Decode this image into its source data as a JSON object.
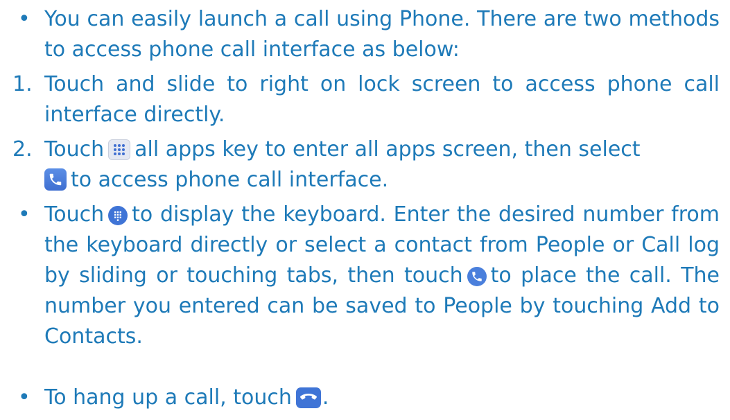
{
  "items": [
    {
      "marker": "•",
      "text": "You can easily launch a call using Phone. There are two methods to access phone call interface as below:"
    },
    {
      "marker": "1.",
      "text": "Touch and slide to right on lock screen to access phone call interface directly."
    },
    {
      "marker": "2.",
      "text_before": "Touch",
      "text_middle": "all apps key to enter all apps screen, then select",
      "text_after": "to access phone call interface."
    },
    {
      "marker": "•",
      "text_before": "Touch",
      "text_middle": "to display the keyboard. Enter the desired number from the keyboard directly or select a contact from People or Call log by sliding or touching tabs, then touch",
      "text_after": "to place the call. The number you entered can be saved to People by touching Add to Contacts."
    },
    {
      "marker": "•",
      "text_before": "To hang up a call, touch",
      "text_after": "."
    }
  ],
  "icons": {
    "all_apps": "all-apps-grid-icon",
    "phone_app": "phone-app-icon",
    "dialpad": "dialpad-icon",
    "call": "call-button-icon",
    "hang_up": "hang-up-icon"
  },
  "colors": {
    "text": "#1e7ab8",
    "icon_blue": "#3f74d6"
  }
}
